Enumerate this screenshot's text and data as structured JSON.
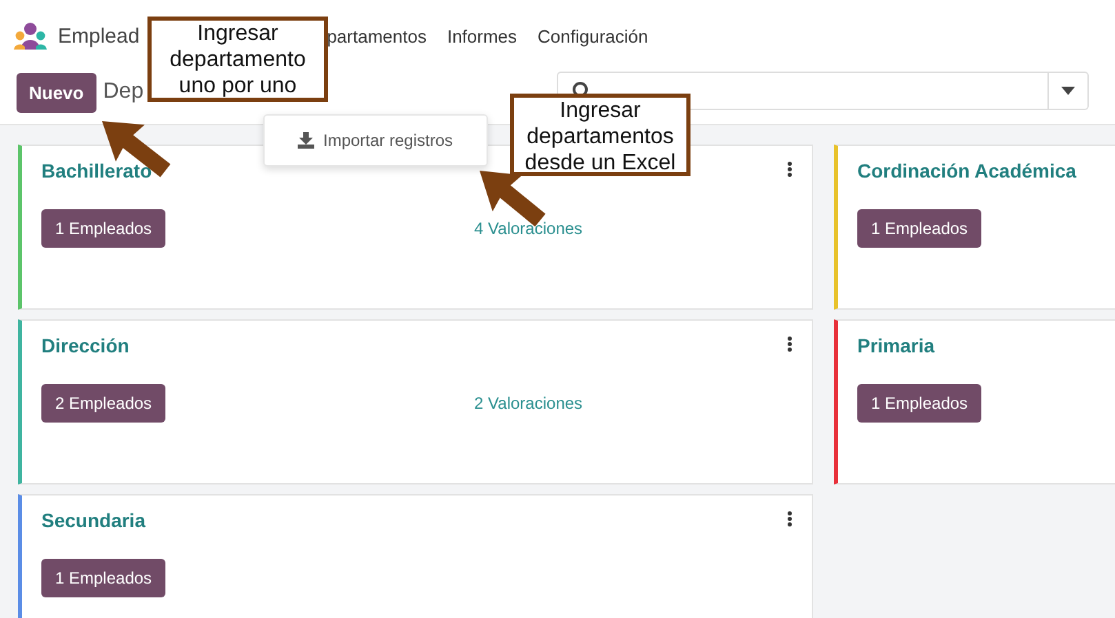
{
  "app": {
    "name": "Emplead",
    "menu": [
      {
        "label": "partamentos"
      },
      {
        "label": "Informes"
      },
      {
        "label": "Configuración"
      }
    ]
  },
  "control_panel": {
    "new_button": "Nuevo",
    "breadcrumb": "Dep"
  },
  "dropdown": {
    "items": [
      {
        "label": "Importar registros"
      }
    ]
  },
  "departments": [
    {
      "name": "Bachillerato",
      "color": "#5cc46a",
      "employees": "1 Empleados",
      "ratings": "4 Valoraciones"
    },
    {
      "name": "Cordinación Académica",
      "color": "#e8c22b",
      "employees": "1 Empleados"
    },
    {
      "name": "Dirección",
      "color": "#3fb4a0",
      "employees": "2 Empleados",
      "ratings": "2 Valoraciones"
    },
    {
      "name": "Primaria",
      "color": "#e8303a",
      "employees": "1 Empleados"
    },
    {
      "name": "Secundaria",
      "color": "#5b8de6",
      "employees": "1 Empleados"
    }
  ],
  "callouts": [
    {
      "lines": [
        "Ingresar",
        "departamento",
        "uno por uno"
      ]
    },
    {
      "lines": [
        "Ingresar",
        "departamentos",
        "desde un Excel"
      ]
    }
  ]
}
